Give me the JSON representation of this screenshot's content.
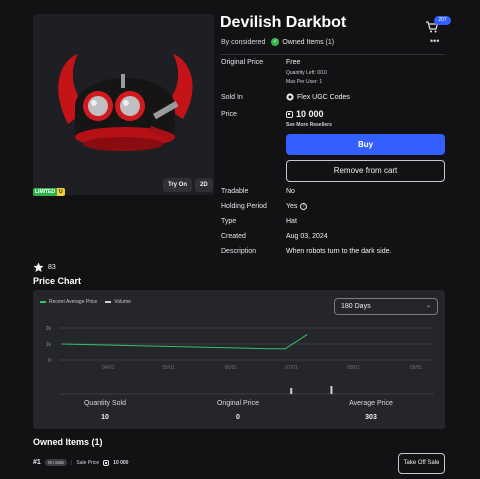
{
  "item": {
    "title": "Devilish Darkbot",
    "creator": "By considered",
    "owned_status": "Owned Items (1)",
    "limited_label": "LIMITED",
    "limited_u": "U",
    "preview_buttons": {
      "try_on": "Try On",
      "view_2d": "2D"
    }
  },
  "header": {
    "cart_count": "207",
    "more": "•••"
  },
  "details": {
    "original_price_label": "Original Price",
    "original_price_value": "Free",
    "quantity_left": "Quantity Left: 0/10",
    "max_per_user": "Max Per User: 1",
    "sold_in_label": "Sold In",
    "sold_in_value": "Flex UGC Codes",
    "price_label": "Price",
    "price_value": "10 000",
    "see_resellers": "See More Resellers",
    "tradable_label": "Tradable",
    "tradable_value": "No",
    "holding_label": "Holding Period",
    "holding_value": "Yes",
    "type_label": "Type",
    "type_value": "Hat",
    "created_label": "Created",
    "created_value": "Aug 03, 2024",
    "description_label": "Description",
    "description_value": "When robots turn to the dark side."
  },
  "actions": {
    "buy": "Buy",
    "remove_from_cart": "Remove from cart",
    "take_off_sale": "Take Off Sale"
  },
  "favorites": {
    "count": "83"
  },
  "price_chart": {
    "title": "Price Chart",
    "legend": [
      "Recent Average Price",
      "Volume"
    ],
    "range_selected": "180 Days",
    "stats": [
      {
        "label": "Quantity Sold",
        "value": "10"
      },
      {
        "label": "Original Price",
        "value": "0"
      },
      {
        "label": "Average Price",
        "value": "303"
      }
    ]
  },
  "chart_data": {
    "type": "line",
    "x_tick_labels": [
      "04/01",
      "05/01",
      "06/01",
      "07/01",
      "08/01",
      "09/01"
    ],
    "y_tick_labels": [
      "2k",
      "1k",
      "0"
    ],
    "ylim": [
      0,
      2500
    ],
    "series": [
      {
        "name": "Recent Average Price",
        "x": [
          "03/09",
          "06/21",
          "06/28",
          "07/09"
        ],
        "values": [
          1000,
          700,
          700,
          1600
        ]
      },
      {
        "name": "Volume",
        "x": [
          "07/01",
          "07/21"
        ],
        "values": [
          3,
          4
        ]
      }
    ],
    "colors": {
      "price": "#33c26b",
      "volume": "#d0d0d4"
    }
  },
  "owned_items": {
    "title": "Owned Items (1)",
    "rows": [
      {
        "index": "#1",
        "status": "On Sale",
        "sale_price_label": "Sale Price",
        "sale_price": "10 000"
      }
    ]
  }
}
